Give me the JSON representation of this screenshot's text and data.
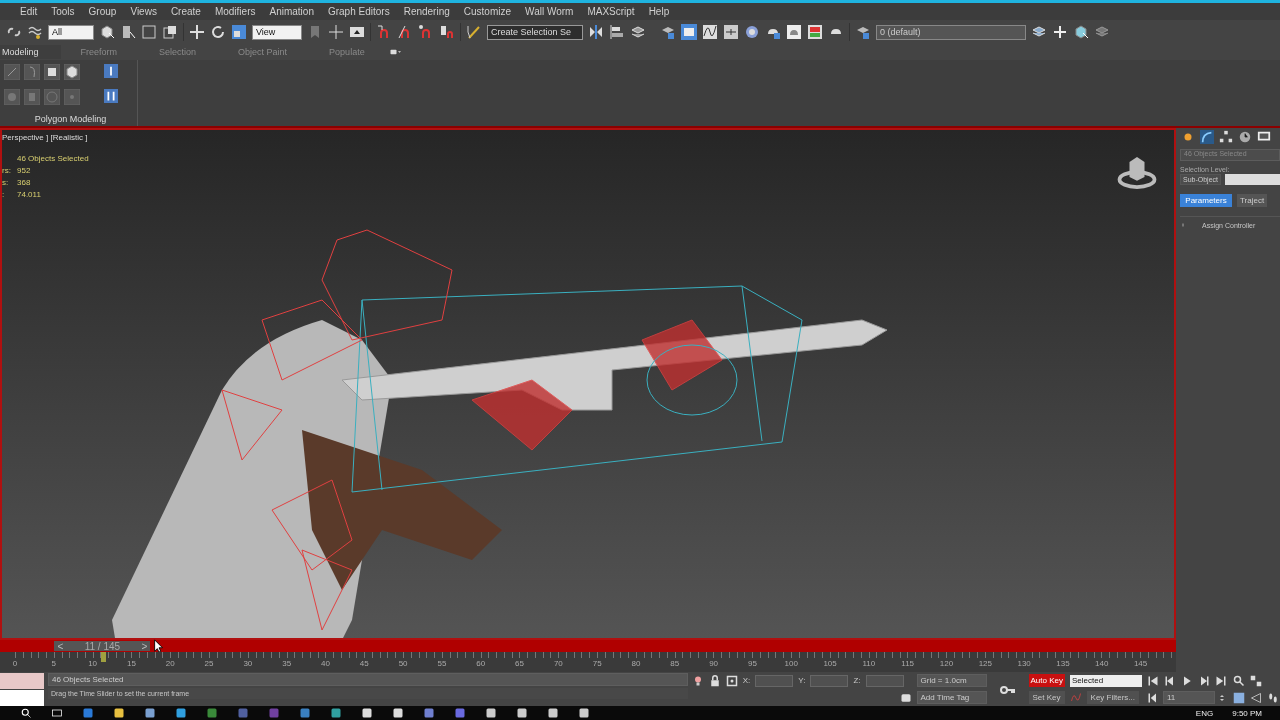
{
  "menu": [
    "Edit",
    "Tools",
    "Group",
    "Views",
    "Create",
    "Modifiers",
    "Animation",
    "Graph Editors",
    "Rendering",
    "Customize",
    "Wall Worm",
    "MAXScript",
    "Help"
  ],
  "toolbar": {
    "selection_filter": "All",
    "reference_coordinate": "View",
    "named_selection": "Create Selection Se",
    "layer": "0 (default)"
  },
  "ribbon": {
    "tabs": [
      {
        "label": "Modeling",
        "selected": true
      },
      {
        "label": "Freeform",
        "selected": false
      },
      {
        "label": "Selection",
        "selected": false
      },
      {
        "label": "Object Paint",
        "selected": false
      },
      {
        "label": "Populate",
        "selected": false
      }
    ],
    "panel_label": "Polygon Modeling"
  },
  "viewport": {
    "label": "Perspective ] [Realistic ]",
    "selection": "46 Objects Selected",
    "stats": [
      {
        "label": "rs:",
        "value": "952"
      },
      {
        "label": "s:",
        "value": "368"
      },
      {
        "label": ":",
        "value": "74.011"
      }
    ]
  },
  "command_panel": {
    "selection": "46 Objects Selected",
    "selection_level_label": "Selection Level:",
    "sub_object": "Sub-Object",
    "tabs": [
      {
        "label": "Parameters",
        "selected": true
      },
      {
        "label": "Traject",
        "selected": false
      }
    ],
    "rollout": "Assign Controller"
  },
  "time_slider": {
    "prev": "<",
    "frame": "11 / 145",
    "next": ">",
    "level": 0.076
  },
  "track_bar": {
    "ticks": [
      "0",
      "5",
      "10",
      "15",
      "20",
      "25",
      "30",
      "35",
      "40",
      "45",
      "50",
      "55",
      "60",
      "65",
      "70",
      "75",
      "80",
      "85",
      "90",
      "95",
      "100",
      "105",
      "110",
      "115",
      "120",
      "125",
      "130",
      "135",
      "140",
      "145"
    ]
  },
  "status": {
    "selection": "46 Objects Selected",
    "prompt": "Drag the Time Slider to set the current frame",
    "x_label": "X:",
    "y_label": "Y:",
    "z_label": "Z:",
    "grid": "Grid = 1.0cm",
    "time_tag": "Add Time Tag"
  },
  "animation": {
    "auto_key": {
      "label": "Auto Key",
      "on": true
    },
    "key_mode": "Selected",
    "set_key": "Set Key",
    "key_filters": "Key Filters...",
    "current_frame": "11"
  },
  "taskbar": {
    "language": "ENG",
    "time": "9:50 PM"
  }
}
